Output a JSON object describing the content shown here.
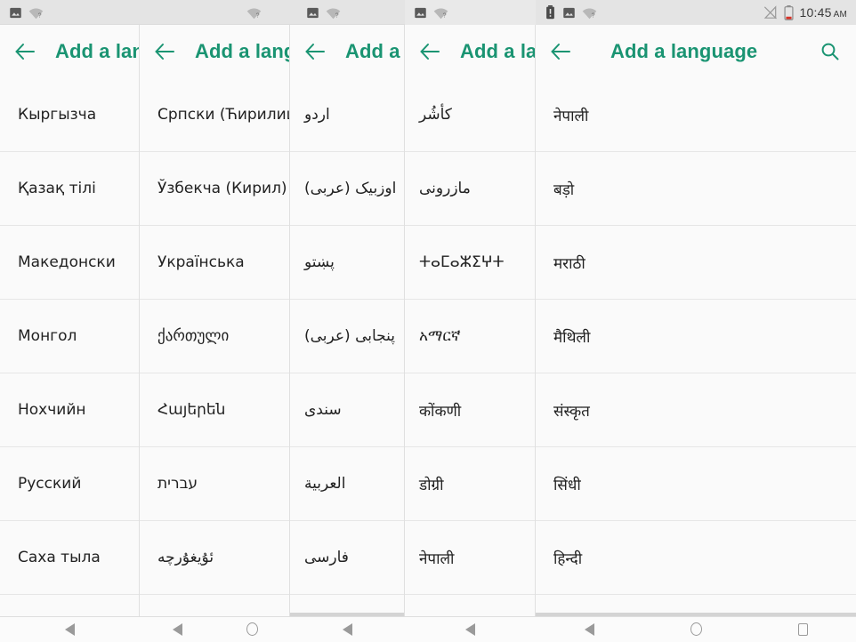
{
  "status_bar": {
    "time": "10:45",
    "ampm": "AM",
    "left_icons": [
      "image-icon",
      "wifi-unknown-icon"
    ],
    "panel5_left_icons": [
      "battery-alert-icon",
      "image-icon",
      "wifi-unknown-icon"
    ],
    "right_icons": [
      "signal-off-icon",
      "battery-low-icon"
    ]
  },
  "toolbar": {
    "title": "Add a language",
    "back_icon": "arrow-back-icon",
    "search_icon": "search-icon",
    "accent_color": "#1a9472"
  },
  "panels": [
    {
      "id": "panel-1",
      "title": "Add a language",
      "has_search": false,
      "script": "cyrillic",
      "rtl": false,
      "items": [
        "Кыргызча",
        "Қазақ тілі",
        "Македонски",
        "Монгол",
        "Нохчийн",
        "Русский",
        "Саха тыла"
      ]
    },
    {
      "id": "panel-2",
      "title": "Add a language",
      "has_search": false,
      "script": "mixed",
      "rtl": false,
      "items": [
        "Српски (Ћирилица)",
        "Ўзбекча (Кирил)",
        "Українська",
        "ქართული",
        "Հայերեն",
        "עברית",
        "ئۇيغۇرچە"
      ]
    },
    {
      "id": "panel-3",
      "title": "Add a language",
      "has_search": false,
      "script": "arabic",
      "rtl": true,
      "items": [
        "اردو",
        "اوزبیک (عربی)",
        "پښتو",
        "پنجابی (عربی)",
        "سندی",
        "العربية",
        "فارسی"
      ]
    },
    {
      "id": "panel-4",
      "title": "Add a language",
      "has_search": false,
      "script": "mixed",
      "rtl": false,
      "items": [
        "كأشُر",
        "مازرونی",
        "ⵜⴰⵎⴰⵣⵉⵖⵜ",
        "አማርኛ",
        "कोंकणी",
        "डोग्री",
        "नेपाली"
      ]
    },
    {
      "id": "panel-5",
      "title": "Add a language",
      "has_search": true,
      "script": "devanagari",
      "rtl": false,
      "items": [
        "नेपाली",
        "बड़ो",
        "मराठी",
        "मैथिली",
        "संस्कृत",
        "सिंधी",
        "हिन्दी"
      ]
    }
  ],
  "nav_bar": {
    "segments": [
      {
        "buttons": [
          "back-nav-icon"
        ]
      },
      {
        "buttons": [
          "back-nav-icon",
          "home-nav-icon"
        ]
      },
      {
        "buttons": [
          "back-nav-icon"
        ]
      },
      {
        "buttons": [
          "back-nav-icon"
        ]
      },
      {
        "buttons": [
          "back-nav-icon",
          "home-nav-icon",
          "recents-nav-icon"
        ]
      }
    ]
  }
}
